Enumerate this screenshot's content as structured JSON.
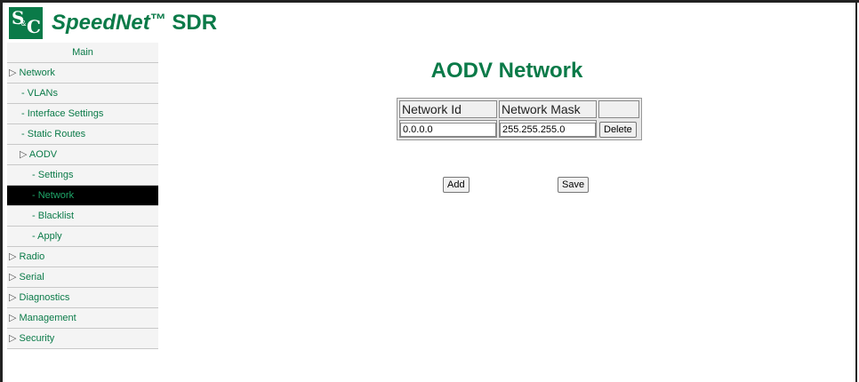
{
  "header": {
    "brand": "SpeedNet",
    "trademark": "™",
    "product": "SDR",
    "logo_letters": {
      "s": "S",
      "amp": "&",
      "c": "C"
    }
  },
  "colors": {
    "brand_green": "#0a7a48",
    "active_bg": "#000000",
    "active_text": "#1fa86a"
  },
  "sidebar": {
    "items": [
      {
        "label": "Main",
        "prefix": ""
      },
      {
        "label": "Network",
        "prefix": "▷ "
      },
      {
        "label": "VLANs",
        "prefix": "- "
      },
      {
        "label": "Interface Settings",
        "prefix": "- "
      },
      {
        "label": "Static Routes",
        "prefix": "- "
      },
      {
        "label": "AODV",
        "prefix": "▷ "
      },
      {
        "label": "Settings",
        "prefix": "- "
      },
      {
        "label": "Network",
        "prefix": "- "
      },
      {
        "label": "Blacklist",
        "prefix": "- "
      },
      {
        "label": "Apply",
        "prefix": "- "
      },
      {
        "label": "Radio",
        "prefix": "▷ "
      },
      {
        "label": "Serial",
        "prefix": "▷ "
      },
      {
        "label": "Diagnostics",
        "prefix": "▷ "
      },
      {
        "label": "Management",
        "prefix": "▷ "
      },
      {
        "label": "Security",
        "prefix": "▷ "
      }
    ]
  },
  "main": {
    "title": "AODV Network",
    "table": {
      "headers": [
        "Network Id",
        "Network Mask",
        ""
      ],
      "rows": [
        {
          "network_id": "0.0.0.0",
          "network_mask": "255.255.255.0",
          "action": "Delete"
        }
      ]
    },
    "add_label": "Add",
    "save_label": "Save"
  }
}
